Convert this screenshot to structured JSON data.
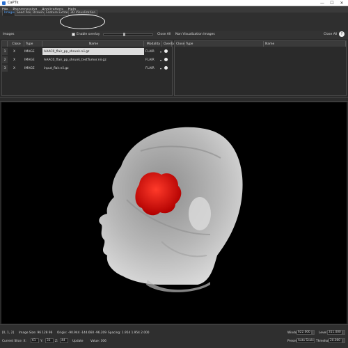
{
  "window": {
    "title": "CaPTk",
    "controls": [
      "—",
      "☐",
      "✕"
    ]
  },
  "menu": [
    "File",
    "Preprocessing",
    "Applications",
    "Help"
  ],
  "tabs": [
    "Images",
    "Seed Points",
    "Drawing",
    "Feature Extraction",
    "3D Visualization"
  ],
  "images_bar": {
    "label": "Images",
    "enable_overlay": "Enable overlay",
    "close_all_left": "Close All",
    "non_vis_label": "Non Visualization Images",
    "close_all_right": "Close All",
    "help": "?"
  },
  "left_table": {
    "headers": [
      "Close",
      "Type",
      "Name",
      "Modality",
      "Overlay"
    ],
    "rows": [
      {
        "idx": "1",
        "close": "X",
        "type": "IMAGE",
        "name": "AAAC0_flair_pp_shrunk.nii.gz",
        "modality": "FLAIR",
        "selected": true
      },
      {
        "idx": "2",
        "close": "X",
        "type": "IMAGE",
        "name": "AAAC0_flair_pp_shrunk_testTumor.nii.gz",
        "modality": "FLAIR",
        "selected": false
      },
      {
        "idx": "3",
        "close": "X",
        "type": "IMAGE",
        "name": "input_flair.nii.gz",
        "modality": "FLAIR",
        "selected": false
      }
    ]
  },
  "right_table": {
    "headers": [
      "Close",
      "Type",
      "Name"
    ]
  },
  "status": {
    "coords": "[0, 1, 2]",
    "image_size": "Image Size: 96 128 96",
    "origin": "Origin: -90.944 -144.660 -96.209",
    "spacing": "Spacing: 1.954 1.954 2.000",
    "current_slice_label": "Current Slice: X:",
    "slice_x": "61",
    "y_label": "Y:",
    "slice_y": "33",
    "z_label": "Z:",
    "slice_z": "44",
    "update": "Update",
    "value": "Value: 306",
    "window_label": "Window",
    "window_value": "622.000",
    "level_label": "Level",
    "level_value": "311.000",
    "preset_label": "Preset",
    "preset_value": "Auto Scale",
    "threshold_label": "Threshold",
    "threshold_value": "20.000"
  },
  "colors": {
    "accent": "#5aa7ff",
    "tumor": "#e01010",
    "viewer_bg": "#000000"
  }
}
